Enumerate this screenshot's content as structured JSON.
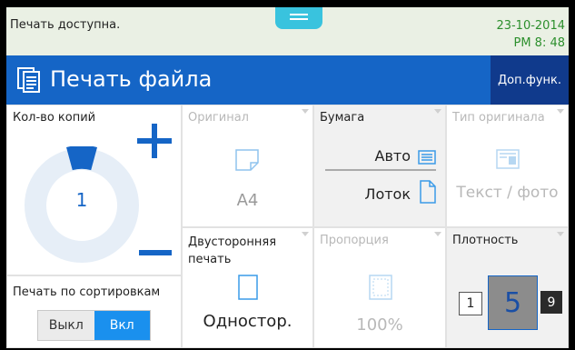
{
  "status": {
    "message": "Печать доступна.",
    "date": "23-10-2014",
    "time": "PM 8: 48"
  },
  "header": {
    "title": "Печать файла",
    "extra_label": "Доп.функ."
  },
  "copies": {
    "label": "Кол-во копий",
    "value": "1"
  },
  "sort": {
    "label": "Печать по сортировкам",
    "off_label": "Выкл",
    "on_label": "Вкл",
    "selected": "Вкл"
  },
  "original": {
    "label": "Оригинал",
    "value": "A4"
  },
  "paper": {
    "label": "Бумага",
    "auto_label": "Авто",
    "tray_label": "Лоток"
  },
  "original_type": {
    "label": "Тип оригинала",
    "value": "Текст / фото"
  },
  "duplex": {
    "label": "Двусторонняя печать",
    "value": "Одностор."
  },
  "ratio": {
    "label": "Пропорция",
    "value": "100%"
  },
  "density": {
    "label": "Плотность",
    "low": "1",
    "value": "5",
    "high": "9"
  },
  "colors": {
    "accent": "#1565c6",
    "header_dark": "#103a8c",
    "status_bg": "#eaf0e4",
    "toggle_on": "#1a90ee",
    "handle": "#39c3de",
    "date_text": "#2c8f2c"
  },
  "icons": [
    "handle-icon",
    "document-stack-icon",
    "plus-icon",
    "minus-icon",
    "page-icon",
    "tray-icon",
    "text-photo-icon",
    "simplex-icon",
    "zoom-icon"
  ]
}
